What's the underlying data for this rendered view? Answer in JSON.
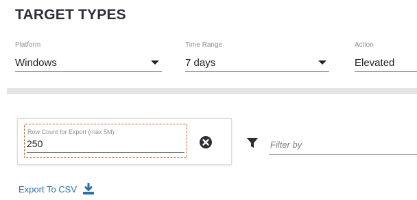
{
  "page": {
    "title": "TARGET TYPES"
  },
  "filters": {
    "platform": {
      "label": "Platform",
      "value": "Windows"
    },
    "time_range": {
      "label": "Time Range",
      "value": "7 days"
    },
    "action": {
      "label": "Action",
      "value": "Elevated"
    }
  },
  "export": {
    "row_count_label": "Row Count for Export (max 5M)",
    "row_count_value": "250",
    "filter_placeholder": "Filter by",
    "export_csv_label": "Export To CSV"
  },
  "colors": {
    "focus_outline": "#c9541c",
    "link": "#2a6fa8",
    "divider": "#e4e4e4"
  },
  "icons": [
    "chevron-down-icon",
    "clear-icon",
    "filter-icon",
    "download-icon"
  ]
}
